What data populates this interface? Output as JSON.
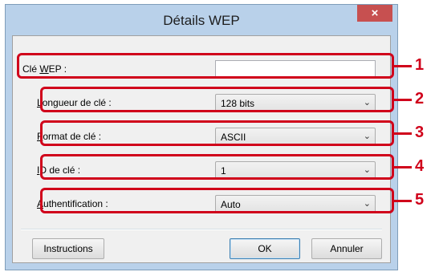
{
  "window": {
    "title": "Détails WEP",
    "close_glyph": "×"
  },
  "fields": [
    {
      "label_prefix": "Clé ",
      "label_accel": "W",
      "label_rest": "EP :",
      "type": "text",
      "value": ""
    },
    {
      "label_prefix": "",
      "label_accel": "L",
      "label_rest": "ongueur de clé :",
      "type": "select",
      "value": "128 bits"
    },
    {
      "label_prefix": "",
      "label_accel": "F",
      "label_rest": "ormat de clé :",
      "type": "select",
      "value": "ASCII"
    },
    {
      "label_prefix": "",
      "label_accel": "I",
      "label_rest": "D de clé :",
      "type": "select",
      "value": "1"
    },
    {
      "label_prefix": "",
      "label_accel": "A",
      "label_rest": "uthentification :",
      "type": "select",
      "value": "Auto"
    }
  ],
  "callouts": [
    "1",
    "2",
    "3",
    "4",
    "5"
  ],
  "buttons": {
    "instructions": "Instructions",
    "ok": "OK",
    "cancel": "Annuler"
  },
  "icons": {
    "chevron": "chevron-down-icon",
    "close": "close-icon"
  },
  "colors": {
    "highlight": "#d0021b",
    "title_bar": "#b9d1ea",
    "close_button": "#c75050"
  }
}
